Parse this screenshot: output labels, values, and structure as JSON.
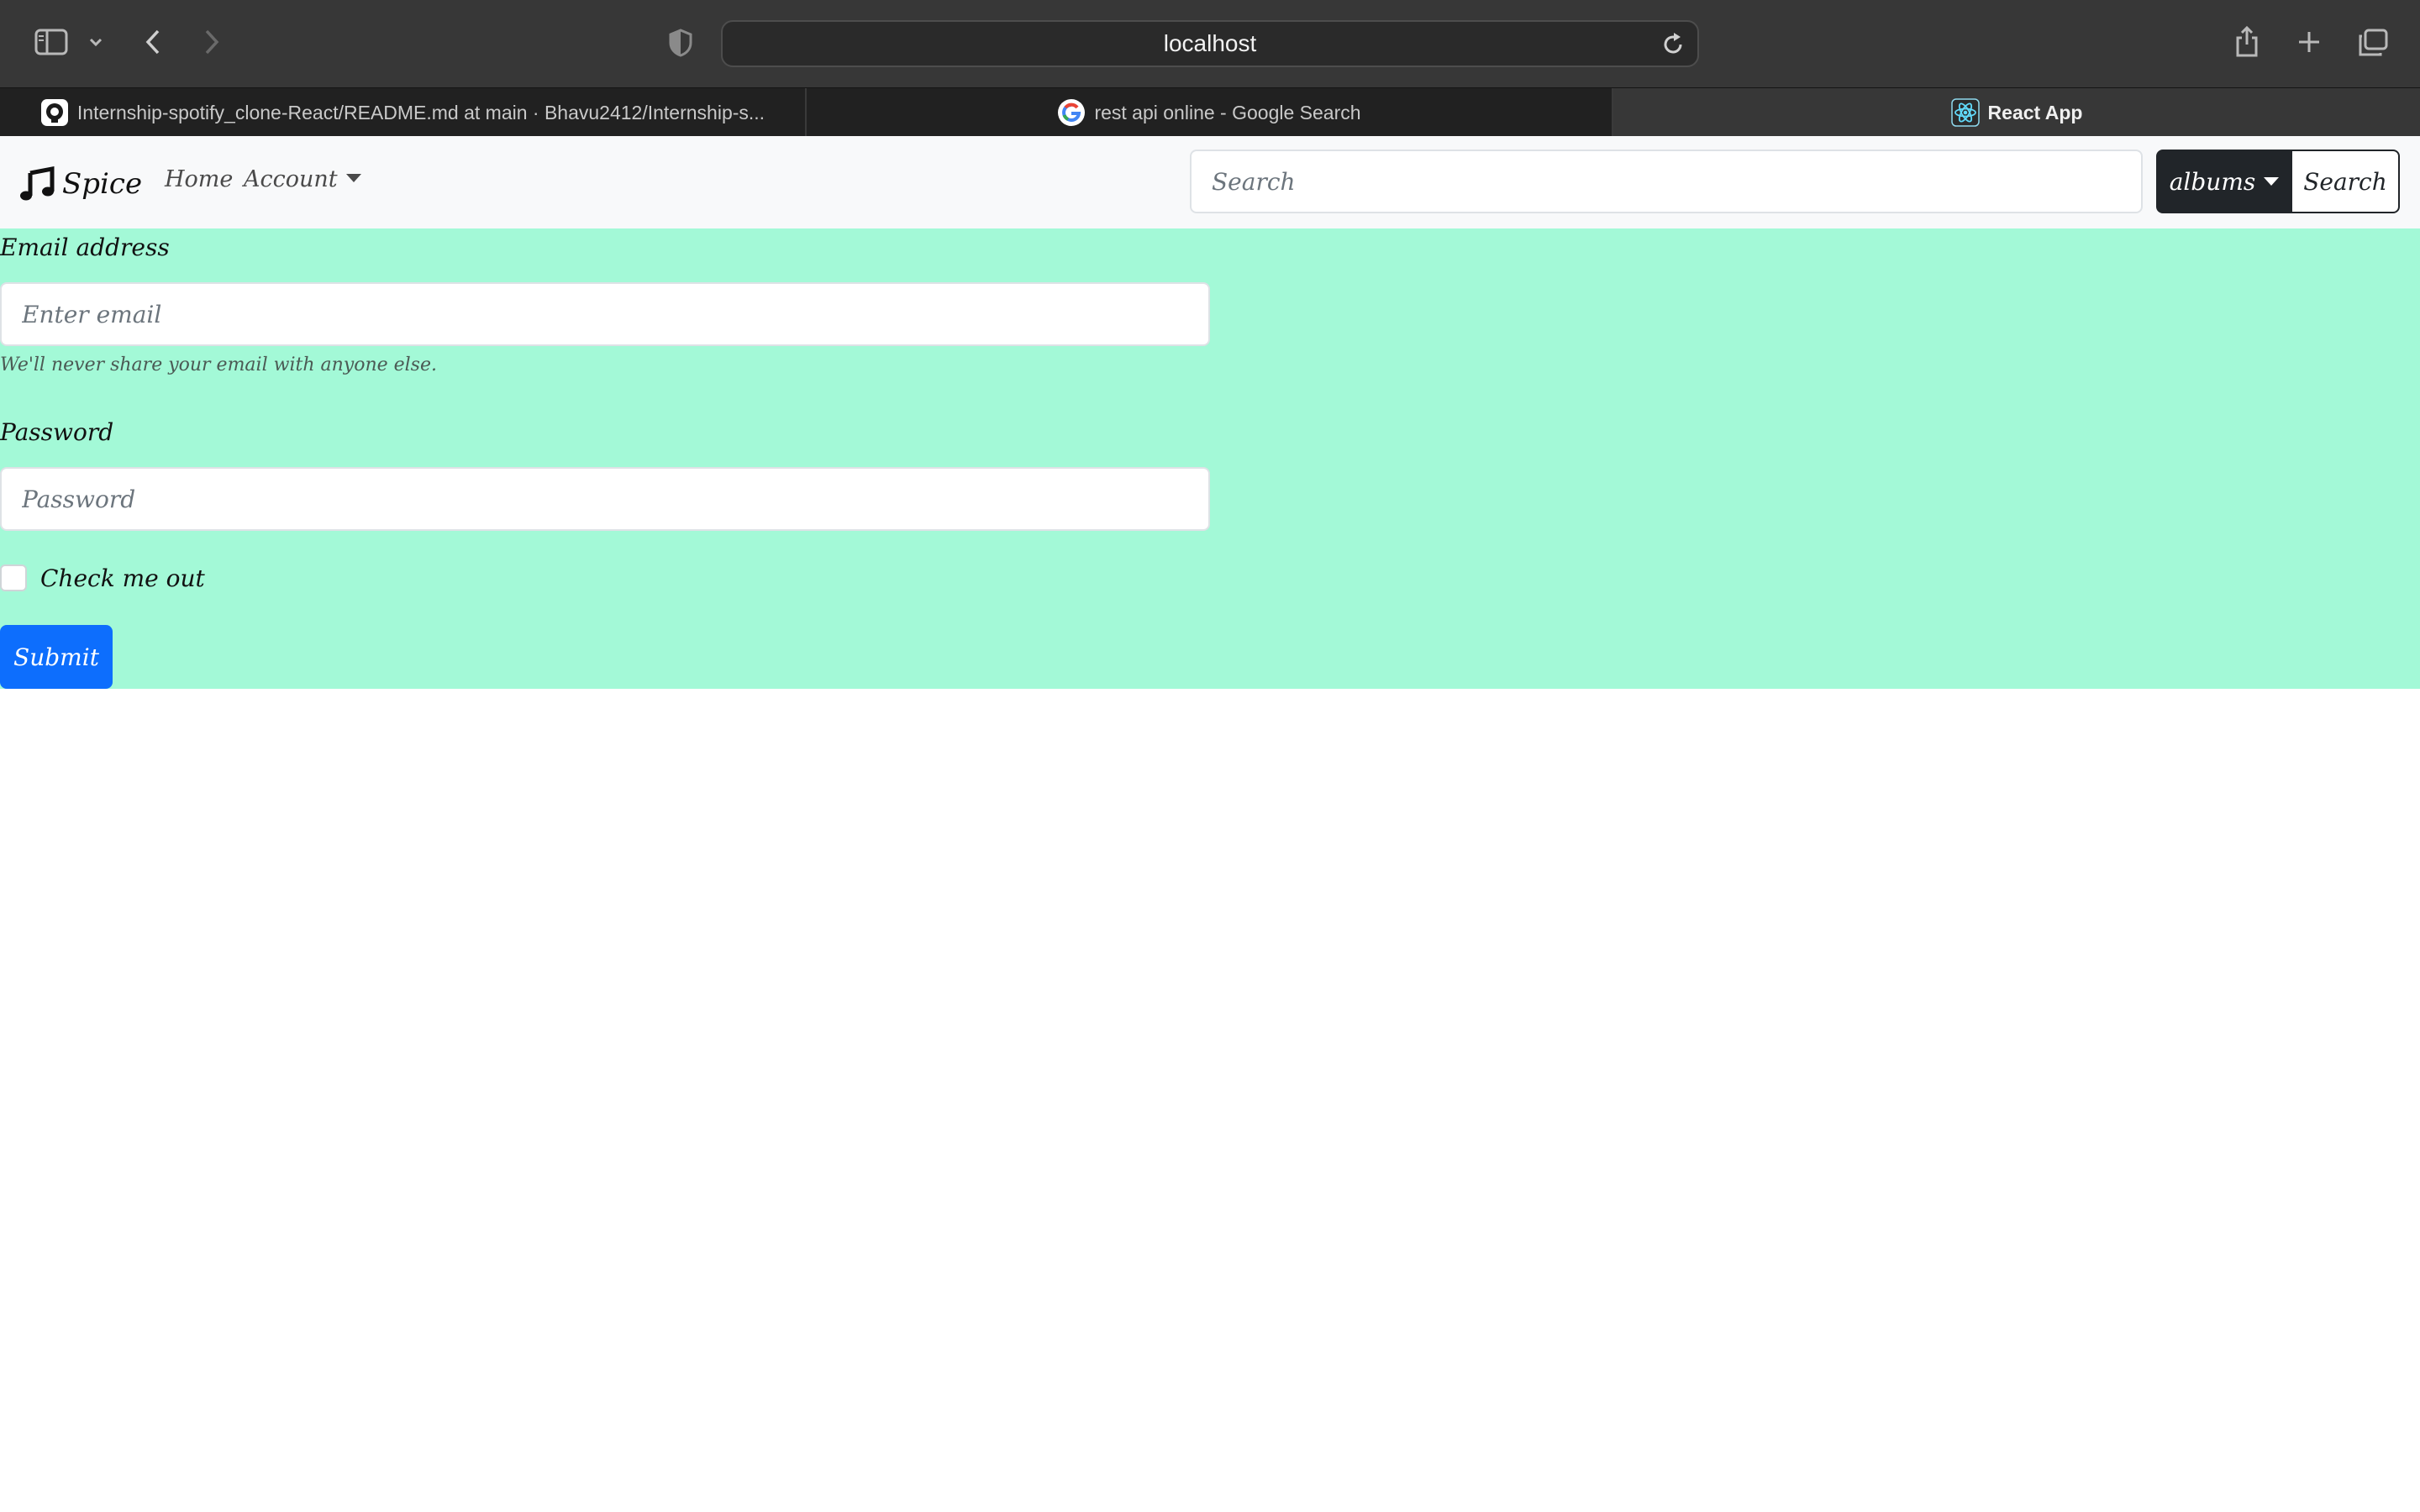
{
  "browser": {
    "address": "localhost",
    "tabs": [
      {
        "title": "Internship-spotify_clone-React/README.md at main · Bhavu2412/Internship-s...",
        "icon": "github-icon"
      },
      {
        "title": "rest api online - Google Search",
        "icon": "google-icon"
      },
      {
        "title": "React App",
        "icon": "react-icon",
        "active": true
      }
    ]
  },
  "navbar": {
    "brand": "Spice",
    "brand_icon": "music-note-icon",
    "home": "Home",
    "account": "Account",
    "search_placeholder": "Search",
    "albums": "albums",
    "search_button": "Search"
  },
  "form": {
    "email_label": "Email address",
    "email_placeholder": "Enter email",
    "email_help": "We'll never share your email with anyone else.",
    "password_label": "Password",
    "password_placeholder": "Password",
    "check_label": "Check me out",
    "submit": "Submit"
  },
  "colors": {
    "form_background": "#a3f9d7",
    "primary": "#0d6efd",
    "dark": "#212529"
  }
}
